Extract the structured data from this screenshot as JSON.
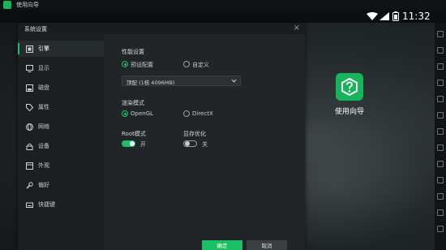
{
  "window": {
    "title": "使用向导"
  },
  "statusbar": {
    "time": "11:32"
  },
  "desktop": {
    "app_label": "使用向导"
  },
  "dialog": {
    "title": "系统设置",
    "nav": [
      {
        "label": "引擎",
        "icon": "engine-icon",
        "active": true
      },
      {
        "label": "显示",
        "icon": "monitor-icon"
      },
      {
        "label": "磁盘",
        "icon": "disk-icon"
      },
      {
        "label": "属性",
        "icon": "tag-icon"
      },
      {
        "label": "网络",
        "icon": "globe-icon"
      },
      {
        "label": "设备",
        "icon": "lock-icon"
      },
      {
        "label": "外观",
        "icon": "appearance-icon"
      },
      {
        "label": "偏好",
        "icon": "wrench-icon"
      },
      {
        "label": "快捷键",
        "icon": "keyboard-icon"
      }
    ],
    "performance": {
      "title": "性能设置",
      "options": [
        "预设配置",
        "自定义"
      ],
      "selected": "预设配置",
      "preset_value": "顶配 (1核 4096MB)"
    },
    "render": {
      "title": "渲染模式",
      "options": [
        "OpenGL",
        "DirectX"
      ],
      "selected": "OpenGL"
    },
    "root": {
      "title": "Root模式",
      "state": "开",
      "on": true
    },
    "memory": {
      "title": "显存优化",
      "state": "关",
      "on": false
    },
    "buttons": {
      "ok": "确定",
      "cancel": "取消"
    }
  },
  "colors": {
    "accent": "#1bc066",
    "dialog_bg": "#212527",
    "nav_bg": "#1b1f20"
  }
}
